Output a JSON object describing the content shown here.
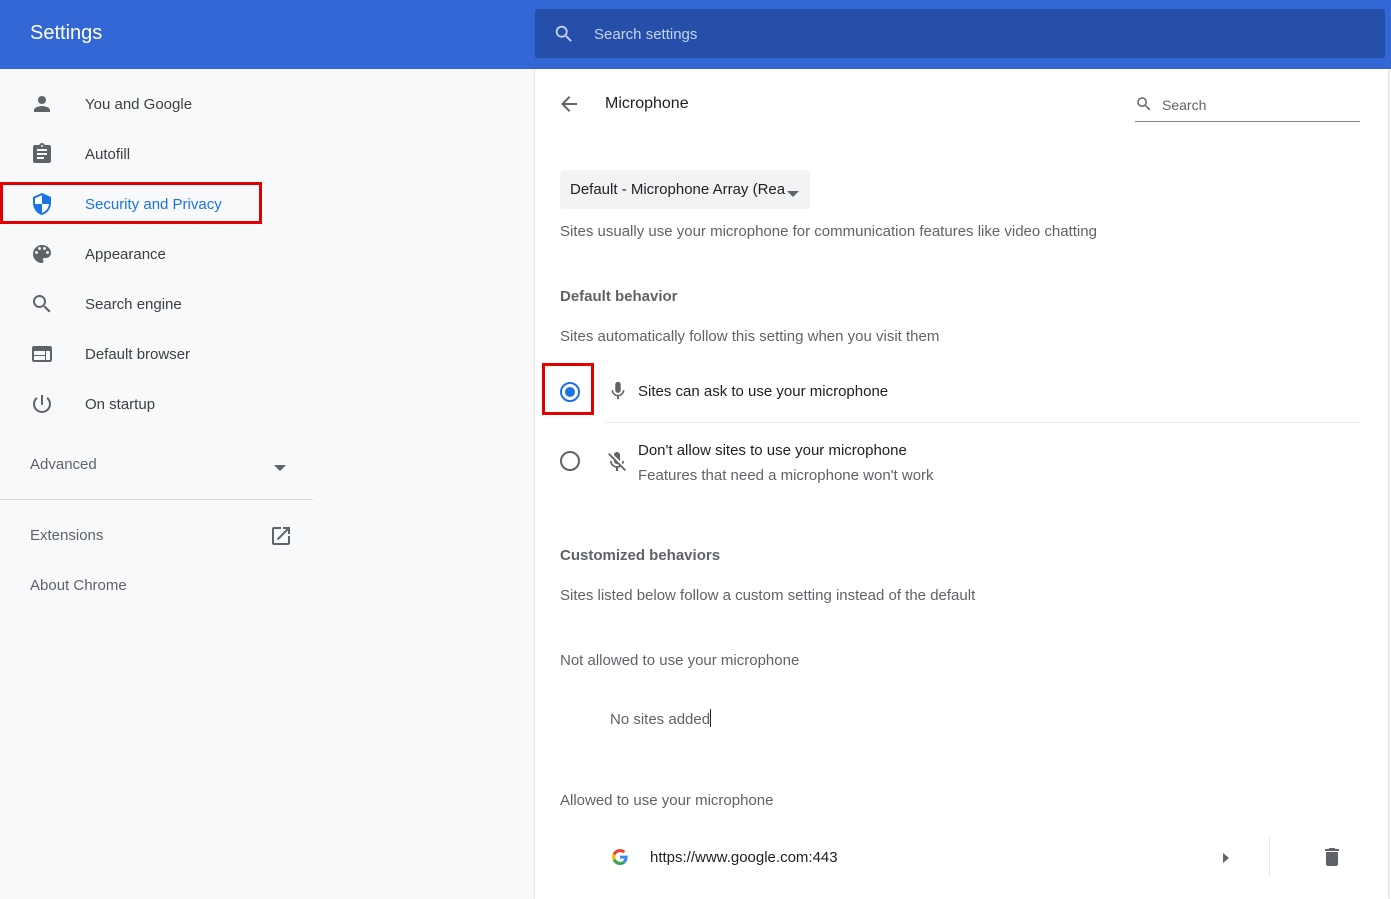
{
  "header": {
    "title": "Settings",
    "search_placeholder": "Search settings"
  },
  "sidebar": {
    "items": [
      {
        "label": "You and Google",
        "icon": "person-icon"
      },
      {
        "label": "Autofill",
        "icon": "clipboard-icon"
      },
      {
        "label": "Security and Privacy",
        "icon": "shield-icon",
        "active": true
      },
      {
        "label": "Appearance",
        "icon": "palette-icon"
      },
      {
        "label": "Search engine",
        "icon": "search-icon"
      },
      {
        "label": "Default browser",
        "icon": "browser-icon"
      },
      {
        "label": "On startup",
        "icon": "power-icon"
      }
    ],
    "advanced_label": "Advanced",
    "extensions_label": "Extensions",
    "about_label": "About Chrome"
  },
  "main": {
    "page_title": "Microphone",
    "search_placeholder": "Search",
    "device_select": "Default - Microphone Array (Realtek Audio)",
    "description": "Sites usually use your microphone for communication features like video chatting",
    "default_behavior": {
      "heading": "Default behavior",
      "subtext": "Sites automatically follow this setting when you visit them",
      "options": [
        {
          "label": "Sites can ask to use your microphone",
          "sublabel": "",
          "checked": true,
          "icon": "microphone-icon"
        },
        {
          "label": "Don't allow sites to use your microphone",
          "sublabel": "Features that need a microphone won't work",
          "checked": false,
          "icon": "microphone-off-icon"
        }
      ]
    },
    "customized": {
      "heading": "Customized behaviors",
      "subtext": "Sites listed below follow a custom setting instead of the default",
      "not_allowed_heading": "Not allowed to use your microphone",
      "not_allowed_empty": "No sites added",
      "allowed_heading": "Allowed to use your microphone",
      "allowed_sites": [
        {
          "url": "https://www.google.com:443",
          "icon": "google-icon"
        }
      ]
    }
  },
  "colors": {
    "header_bg": "#3367d6",
    "search_bg": "#254fa8",
    "accent": "#1a73e8",
    "highlight": "#e00000"
  }
}
